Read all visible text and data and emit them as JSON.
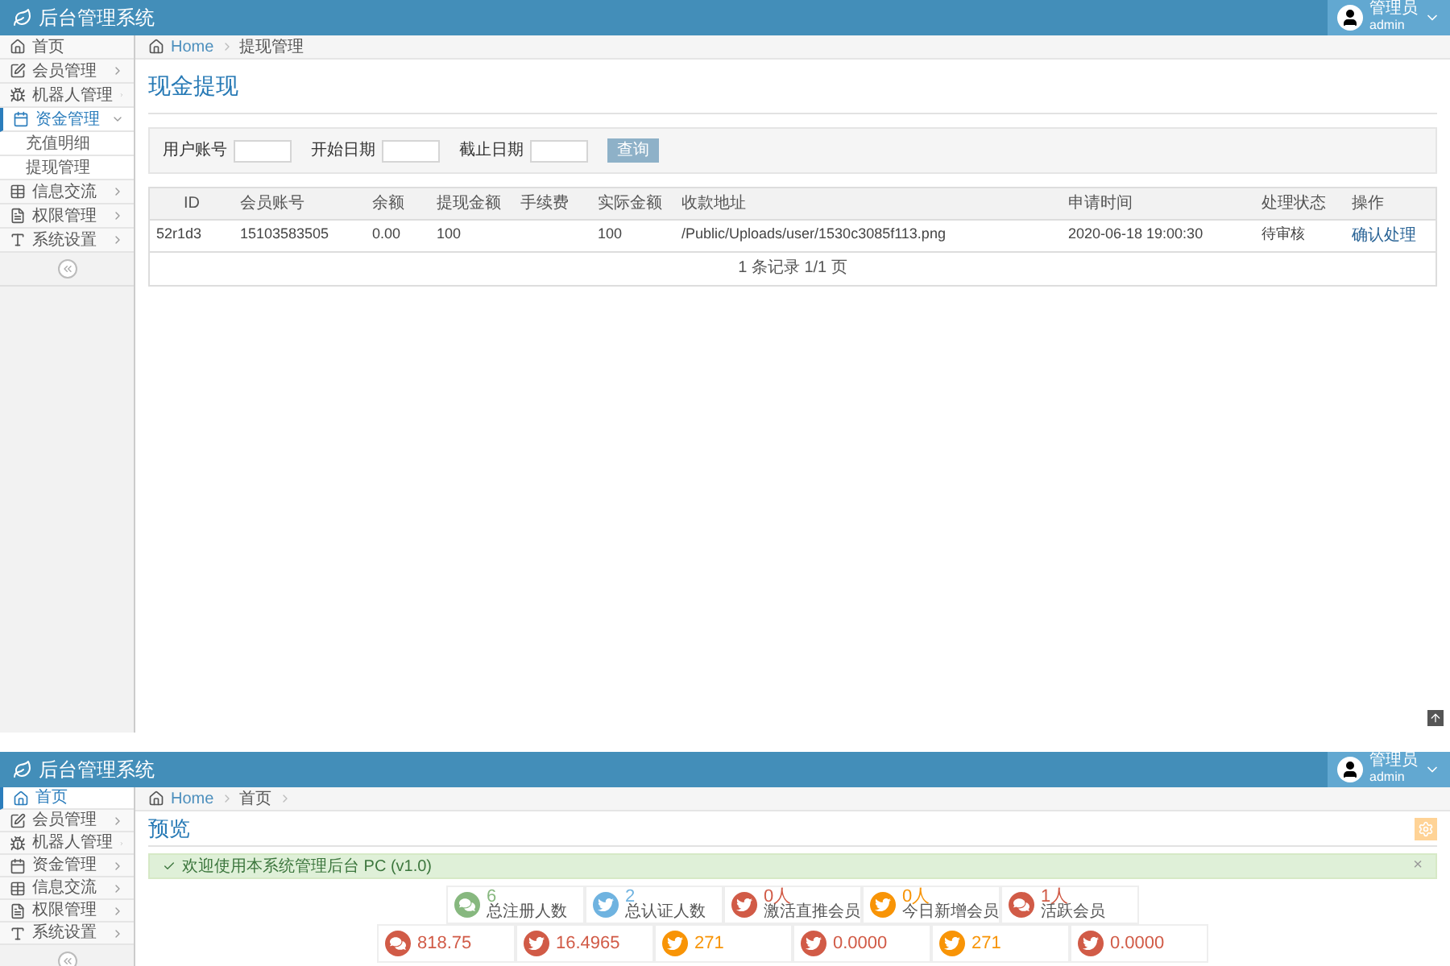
{
  "top": {
    "app_title": "后台管理系统",
    "user": {
      "name": "管理员",
      "role": "admin"
    },
    "sidebar": [
      {
        "label": "首页",
        "selected": false
      },
      {
        "label": "会员管理",
        "selected": false
      },
      {
        "label": "机器人管理",
        "selected": false
      },
      {
        "label": "资金管理",
        "selected": true,
        "children": [
          {
            "label": "充值明细"
          },
          {
            "label": "提现管理"
          }
        ]
      },
      {
        "label": "信息交流",
        "selected": false
      },
      {
        "label": "权限管理",
        "selected": false
      },
      {
        "label": "系统设置",
        "selected": false
      }
    ],
    "breadcrumb": [
      "Home",
      "提现管理"
    ],
    "page_title": "现金提现",
    "filters": [
      {
        "label": "用户账号"
      },
      {
        "label": "开始日期"
      },
      {
        "label": "截止日期"
      }
    ],
    "search_button": "查询",
    "table": {
      "columns": [
        "ID",
        "会员账号",
        "余额",
        "提现金额",
        "手续费",
        "实际金额",
        "收款地址",
        "申请时间",
        "处理状态",
        "操作"
      ],
      "rows": [
        [
          "52r1d3",
          "15103583505",
          "0.00",
          "100",
          null,
          "100",
          "/Public/Uploads/user/1530c3085f113.png",
          "2020-06-18 19:00:30",
          "待审核",
          "确认处理"
        ]
      ],
      "footer": "1 条记录 1/1 页"
    }
  },
  "bottom": {
    "app_title": "后台管理系统",
    "user": {
      "name": "管理员",
      "role": "admin"
    },
    "sidebar": [
      {
        "label": "首页",
        "selected": true
      },
      {
        "label": "会员管理",
        "selected": false
      },
      {
        "label": "机器人管理",
        "selected": false
      },
      {
        "label": "资金管理",
        "selected": false
      },
      {
        "label": "信息交流",
        "selected": false
      },
      {
        "label": "权限管理",
        "selected": false
      },
      {
        "label": "系统设置",
        "selected": false
      }
    ],
    "breadcrumb": [
      "Home",
      "首页"
    ],
    "page_title": "预览",
    "alert": "欢迎使用本系统管理后台 PC (v1.0)",
    "alert_close": "×",
    "stats": [
      [
        {
          "value": "6",
          "label": "总注册人数",
          "kind": "chat",
          "color": "#87b87f"
        },
        {
          "value": "2",
          "label": "总认证人数",
          "kind": "bird",
          "color": "#6fb3e0"
        },
        {
          "value": "0人",
          "label": "激活直推会员",
          "kind": "bird",
          "color": "#d15b47"
        },
        {
          "value": "0人",
          "label": "今日新增会员",
          "kind": "bird",
          "color": "#f89406"
        },
        {
          "value": "1人",
          "label": "活跃会员",
          "kind": "chat",
          "color": "#d15b47"
        }
      ],
      [
        {
          "value": "818.75",
          "kind": "chat",
          "color": "#d15b47"
        },
        {
          "value": "16.4965",
          "kind": "bird",
          "color": "#d15b47"
        },
        {
          "value": "271",
          "kind": "bird",
          "color": "#f89406"
        },
        {
          "value": "0.0000",
          "kind": "bird",
          "color": "#d15b47"
        },
        {
          "value": "271",
          "kind": "bird",
          "color": "#f89406"
        },
        {
          "value": "0.0000",
          "kind": "bird",
          "color": "#d15b47"
        }
      ]
    ]
  }
}
